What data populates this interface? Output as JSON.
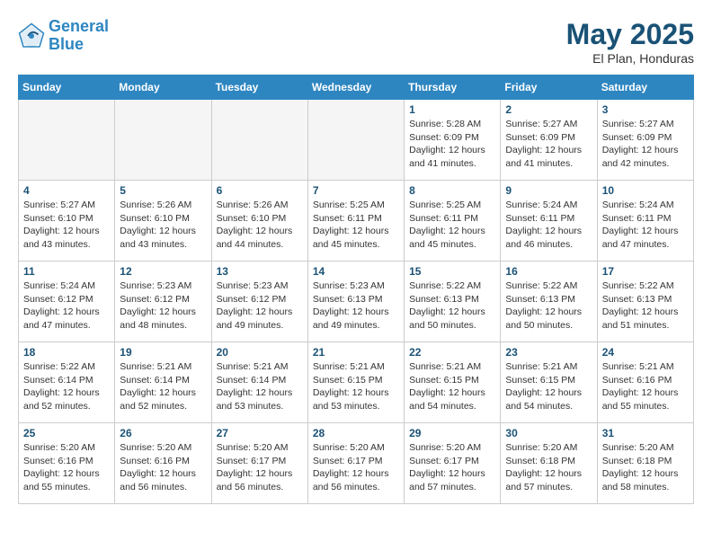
{
  "header": {
    "logo_line1": "General",
    "logo_line2": "Blue",
    "month": "May 2025",
    "location": "El Plan, Honduras"
  },
  "columns": [
    "Sunday",
    "Monday",
    "Tuesday",
    "Wednesday",
    "Thursday",
    "Friday",
    "Saturday"
  ],
  "weeks": [
    [
      {
        "day": "",
        "info": ""
      },
      {
        "day": "",
        "info": ""
      },
      {
        "day": "",
        "info": ""
      },
      {
        "day": "",
        "info": ""
      },
      {
        "day": "1",
        "info": "Sunrise: 5:28 AM\nSunset: 6:09 PM\nDaylight: 12 hours\nand 41 minutes."
      },
      {
        "day": "2",
        "info": "Sunrise: 5:27 AM\nSunset: 6:09 PM\nDaylight: 12 hours\nand 41 minutes."
      },
      {
        "day": "3",
        "info": "Sunrise: 5:27 AM\nSunset: 6:09 PM\nDaylight: 12 hours\nand 42 minutes."
      }
    ],
    [
      {
        "day": "4",
        "info": "Sunrise: 5:27 AM\nSunset: 6:10 PM\nDaylight: 12 hours\nand 43 minutes."
      },
      {
        "day": "5",
        "info": "Sunrise: 5:26 AM\nSunset: 6:10 PM\nDaylight: 12 hours\nand 43 minutes."
      },
      {
        "day": "6",
        "info": "Sunrise: 5:26 AM\nSunset: 6:10 PM\nDaylight: 12 hours\nand 44 minutes."
      },
      {
        "day": "7",
        "info": "Sunrise: 5:25 AM\nSunset: 6:11 PM\nDaylight: 12 hours\nand 45 minutes."
      },
      {
        "day": "8",
        "info": "Sunrise: 5:25 AM\nSunset: 6:11 PM\nDaylight: 12 hours\nand 45 minutes."
      },
      {
        "day": "9",
        "info": "Sunrise: 5:24 AM\nSunset: 6:11 PM\nDaylight: 12 hours\nand 46 minutes."
      },
      {
        "day": "10",
        "info": "Sunrise: 5:24 AM\nSunset: 6:11 PM\nDaylight: 12 hours\nand 47 minutes."
      }
    ],
    [
      {
        "day": "11",
        "info": "Sunrise: 5:24 AM\nSunset: 6:12 PM\nDaylight: 12 hours\nand 47 minutes."
      },
      {
        "day": "12",
        "info": "Sunrise: 5:23 AM\nSunset: 6:12 PM\nDaylight: 12 hours\nand 48 minutes."
      },
      {
        "day": "13",
        "info": "Sunrise: 5:23 AM\nSunset: 6:12 PM\nDaylight: 12 hours\nand 49 minutes."
      },
      {
        "day": "14",
        "info": "Sunrise: 5:23 AM\nSunset: 6:13 PM\nDaylight: 12 hours\nand 49 minutes."
      },
      {
        "day": "15",
        "info": "Sunrise: 5:22 AM\nSunset: 6:13 PM\nDaylight: 12 hours\nand 50 minutes."
      },
      {
        "day": "16",
        "info": "Sunrise: 5:22 AM\nSunset: 6:13 PM\nDaylight: 12 hours\nand 50 minutes."
      },
      {
        "day": "17",
        "info": "Sunrise: 5:22 AM\nSunset: 6:13 PM\nDaylight: 12 hours\nand 51 minutes."
      }
    ],
    [
      {
        "day": "18",
        "info": "Sunrise: 5:22 AM\nSunset: 6:14 PM\nDaylight: 12 hours\nand 52 minutes."
      },
      {
        "day": "19",
        "info": "Sunrise: 5:21 AM\nSunset: 6:14 PM\nDaylight: 12 hours\nand 52 minutes."
      },
      {
        "day": "20",
        "info": "Sunrise: 5:21 AM\nSunset: 6:14 PM\nDaylight: 12 hours\nand 53 minutes."
      },
      {
        "day": "21",
        "info": "Sunrise: 5:21 AM\nSunset: 6:15 PM\nDaylight: 12 hours\nand 53 minutes."
      },
      {
        "day": "22",
        "info": "Sunrise: 5:21 AM\nSunset: 6:15 PM\nDaylight: 12 hours\nand 54 minutes."
      },
      {
        "day": "23",
        "info": "Sunrise: 5:21 AM\nSunset: 6:15 PM\nDaylight: 12 hours\nand 54 minutes."
      },
      {
        "day": "24",
        "info": "Sunrise: 5:21 AM\nSunset: 6:16 PM\nDaylight: 12 hours\nand 55 minutes."
      }
    ],
    [
      {
        "day": "25",
        "info": "Sunrise: 5:20 AM\nSunset: 6:16 PM\nDaylight: 12 hours\nand 55 minutes."
      },
      {
        "day": "26",
        "info": "Sunrise: 5:20 AM\nSunset: 6:16 PM\nDaylight: 12 hours\nand 56 minutes."
      },
      {
        "day": "27",
        "info": "Sunrise: 5:20 AM\nSunset: 6:17 PM\nDaylight: 12 hours\nand 56 minutes."
      },
      {
        "day": "28",
        "info": "Sunrise: 5:20 AM\nSunset: 6:17 PM\nDaylight: 12 hours\nand 56 minutes."
      },
      {
        "day": "29",
        "info": "Sunrise: 5:20 AM\nSunset: 6:17 PM\nDaylight: 12 hours\nand 57 minutes."
      },
      {
        "day": "30",
        "info": "Sunrise: 5:20 AM\nSunset: 6:18 PM\nDaylight: 12 hours\nand 57 minutes."
      },
      {
        "day": "31",
        "info": "Sunrise: 5:20 AM\nSunset: 6:18 PM\nDaylight: 12 hours\nand 58 minutes."
      }
    ]
  ]
}
